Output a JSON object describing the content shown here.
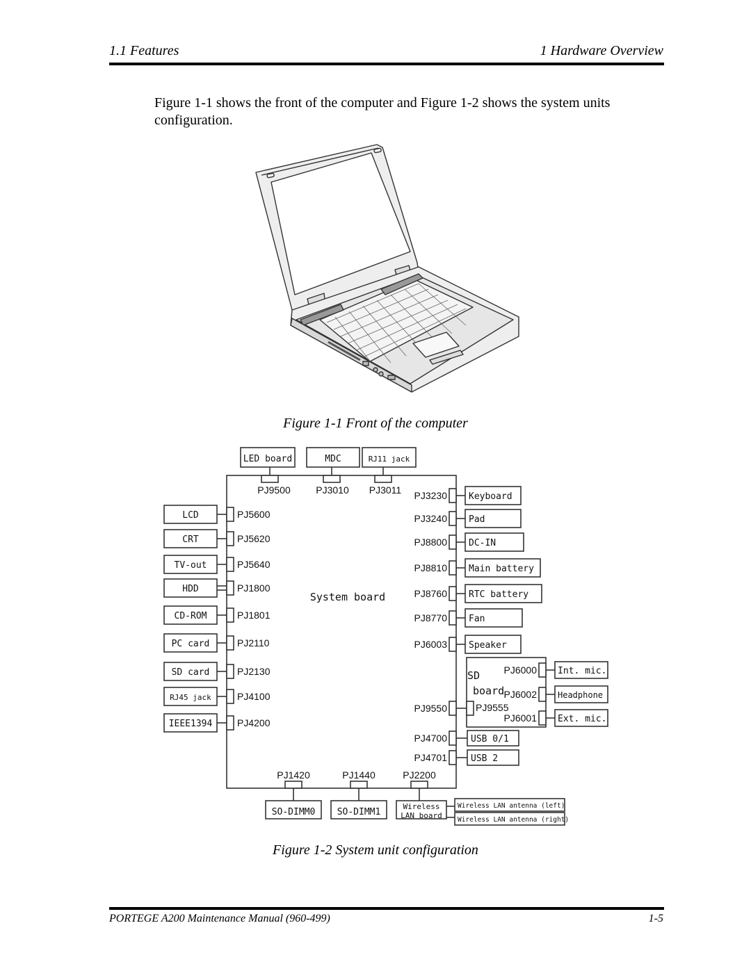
{
  "header": {
    "section": "1.1  Features",
    "chapter": "1  Hardware Overview"
  },
  "intro_text": "Figure 1-1 shows the front of the computer and Figure 1-2 shows the system units configuration.",
  "figure1": {
    "caption": "Figure 1-1  Front of the computer",
    "image": "laptop-front-illustration"
  },
  "figure2": {
    "caption": "Figure 1-2  System unit configuration",
    "system_board_label": "System board",
    "top": [
      {
        "device": "LED board",
        "connector": "PJ9500"
      },
      {
        "device": "MDC",
        "connector": "PJ3010"
      },
      {
        "device": "RJ11 jack",
        "connector": "PJ3011"
      }
    ],
    "left": [
      {
        "device": "LCD",
        "connector": "PJ5600"
      },
      {
        "device": "CRT",
        "connector": "PJ5620"
      },
      {
        "device": "TV-out",
        "connector": "PJ5640"
      },
      {
        "device": "HDD",
        "connector": "PJ1800"
      },
      {
        "device": "CD-ROM",
        "connector": "PJ1801"
      },
      {
        "device": "PC card",
        "connector": "PJ2110"
      },
      {
        "device": "SD card",
        "connector": "PJ2130"
      },
      {
        "device": "RJ45 jack",
        "connector": "PJ4100"
      },
      {
        "device": "IEEE1394",
        "connector": "PJ4200"
      }
    ],
    "right": [
      {
        "device": "Keyboard",
        "connector": "PJ3230"
      },
      {
        "device": "Pad",
        "connector": "PJ3240"
      },
      {
        "device": "DC-IN",
        "connector": "PJ8800"
      },
      {
        "device": "Main battery",
        "connector": "PJ8810"
      },
      {
        "device": "RTC battery",
        "connector": "PJ8760"
      },
      {
        "device": "Fan",
        "connector": "PJ8770"
      },
      {
        "device": "Speaker",
        "connector": "PJ6003"
      },
      {
        "device": "USB 0/1",
        "connector": "PJ4700"
      },
      {
        "device": "USB 2",
        "connector": "PJ4701"
      }
    ],
    "sd_board": {
      "label_line1": "SD",
      "label_line2": "board",
      "board_connector": "PJ9550",
      "sd_connector": "PJ9555",
      "devices": [
        {
          "device": "Int. mic.",
          "connector": "PJ6000"
        },
        {
          "device": "Headphone",
          "connector": "PJ6002"
        },
        {
          "device": "Ext. mic.",
          "connector": "PJ6001"
        }
      ]
    },
    "bottom": [
      {
        "device": "SO-DIMM0",
        "connector": "PJ1420"
      },
      {
        "device": "SO-DIMM1",
        "connector": "PJ1440"
      },
      {
        "device_line1": "Wireless",
        "device_line2": "LAN board",
        "connector": "PJ2200"
      }
    ],
    "antennas": [
      "Wireless LAN antenna (left)",
      "Wireless LAN antenna (right)"
    ]
  },
  "footer": {
    "manual": "PORTEGE A200 Maintenance Manual (960-499)",
    "page": "1-5"
  }
}
